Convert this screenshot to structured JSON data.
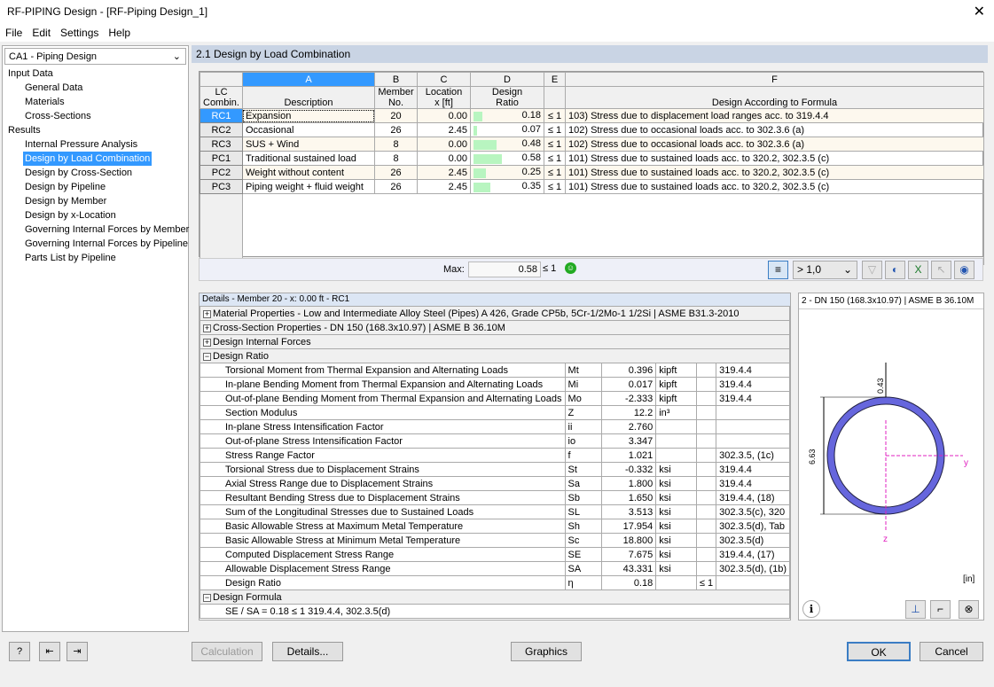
{
  "window": {
    "title": "RF-PIPING Design - [RF-Piping Design_1]"
  },
  "menu": [
    "File",
    "Edit",
    "Settings",
    "Help"
  ],
  "sidebar": {
    "case": "CA1 - Piping Design",
    "groups": [
      {
        "label": "Input Data",
        "items": [
          "General Data",
          "Materials",
          "Cross-Sections"
        ]
      },
      {
        "label": "Results",
        "items": [
          "Internal Pressure Analysis",
          "Design by Load Combination",
          "Design by Cross-Section",
          "Design by Pipeline",
          "Design by Member",
          "Design by x-Location",
          "Governing Internal Forces by Member",
          "Governing Internal Forces by Pipeline",
          "Parts List by Pipeline"
        ]
      }
    ],
    "selected": "Design by Load Combination"
  },
  "main": {
    "title": "2.1 Design by Load Combination",
    "columns": {
      "letters": [
        "A",
        "B",
        "C",
        "D",
        "E",
        "F"
      ],
      "lc": [
        "LC",
        "Combin."
      ],
      "desc": "Description",
      "member": [
        "Member",
        "No."
      ],
      "loc": [
        "Location",
        "x [ft]"
      ],
      "design": [
        "Design",
        "Ratio"
      ],
      "formula": "Design According to Formula"
    },
    "rows": [
      {
        "lc": "RC1",
        "desc": "Expansion",
        "member": "20",
        "x": "0.00",
        "ratio": 0.18,
        "ratio_text": "0.18",
        "le": "≤ 1",
        "formula": "103) Stress due to displacement load ranges acc. to 319.4.4"
      },
      {
        "lc": "RC2",
        "desc": "Occasional",
        "member": "26",
        "x": "2.45",
        "ratio": 0.07,
        "ratio_text": "0.07",
        "le": "≤ 1",
        "formula": "102) Stress due to occasional loads acc. to 302.3.6 (a)"
      },
      {
        "lc": "RC3",
        "desc": "SUS + Wind",
        "member": "8",
        "x": "0.00",
        "ratio": 0.48,
        "ratio_text": "0.48",
        "le": "≤ 1",
        "formula": "102) Stress due to occasional loads acc. to 302.3.6 (a)"
      },
      {
        "lc": "PC1",
        "desc": "Traditional sustained load",
        "member": "8",
        "x": "0.00",
        "ratio": 0.58,
        "ratio_text": "0.58",
        "le": "≤ 1",
        "formula": "101) Stress due to sustained loads acc. to 320.2, 302.3.5 (c)"
      },
      {
        "lc": "PC2",
        "desc": "Weight without content",
        "member": "26",
        "x": "2.45",
        "ratio": 0.25,
        "ratio_text": "0.25",
        "le": "≤ 1",
        "formula": "101) Stress due to sustained loads acc. to 320.2, 302.3.5 (c)"
      },
      {
        "lc": "PC3",
        "desc": "Piping weight + fluid weight",
        "member": "26",
        "x": "2.45",
        "ratio": 0.35,
        "ratio_text": "0.35",
        "le": "≤ 1",
        "formula": "101) Stress due to sustained loads acc. to 320.2, 302.3.5 (c)"
      }
    ],
    "max_label": "Max:",
    "max_value": "0.58",
    "max_le": "≤ 1",
    "filter_value": "> 1,0"
  },
  "details": {
    "title": "Details - Member 20 - x: 0.00 ft - RC1",
    "sections": [
      "Material Properties - Low and Intermediate Alloy Steel (Pipes) A 426, Grade CP5b, 5Cr-1/2Mo-1 1/2Si | ASME B31.3-2010",
      "Cross-Section Properties - DN 150 (168.3x10.97) | ASME B 36.10M",
      "Design Internal Forces",
      "Design Ratio"
    ],
    "rows": [
      [
        "Torsional Moment from Thermal Expansion and Alternating Loads",
        "Mt",
        "0.396",
        "kipft",
        "",
        "319.4.4"
      ],
      [
        "In-plane Bending Moment from Thermal Expansion and Alternating Loads",
        "Mi",
        "0.017",
        "kipft",
        "",
        "319.4.4"
      ],
      [
        "Out-of-plane Bending Moment from Thermal Expansion and Alternating Loads",
        "Mo",
        "-2.333",
        "kipft",
        "",
        "319.4.4"
      ],
      [
        "Section Modulus",
        "Z",
        "12.2",
        "in³",
        "",
        ""
      ],
      [
        "In-plane Stress Intensification Factor",
        "ii",
        "2.760",
        "",
        "",
        ""
      ],
      [
        "Out-of-plane Stress Intensification Factor",
        "io",
        "3.347",
        "",
        "",
        ""
      ],
      [
        "Stress Range Factor",
        "f",
        "1.021",
        "",
        "",
        "302.3.5, (1c)"
      ],
      [
        "Torsional Stress due to Displacement Strains",
        "St",
        "-0.332",
        "ksi",
        "",
        "319.4.4"
      ],
      [
        "Axial Stress Range due to Displacement Strains",
        "Sa",
        "1.800",
        "ksi",
        "",
        "319.4.4"
      ],
      [
        "Resultant Bending Stress due to Displacement Strains",
        "Sb",
        "1.650",
        "ksi",
        "",
        "319.4.4, (18)"
      ],
      [
        "Sum of the Longitudinal Stresses due to Sustained Loads",
        "SL",
        "3.513",
        "ksi",
        "",
        "302.3.5(c), 320"
      ],
      [
        "Basic Allowable Stress at Maximum Metal Temperature",
        "Sh",
        "17.954",
        "ksi",
        "",
        "302.3.5(d), Tab"
      ],
      [
        "Basic Allowable Stress at Minimum Metal Temperature",
        "Sc",
        "18.800",
        "ksi",
        "",
        "302.3.5(d)"
      ],
      [
        "Computed Displacement Stress Range",
        "SE",
        "7.675",
        "ksi",
        "",
        "319.4.4, (17)"
      ],
      [
        "Allowable Displacement Stress Range",
        "SA",
        "43.331",
        "ksi",
        "",
        "302.3.5(d), (1b)"
      ],
      [
        "Design Ratio",
        "η",
        "0.18",
        "",
        "≤ 1",
        ""
      ]
    ],
    "formula_section": "Design Formula",
    "formula": "SE / SA = 0.18 ≤ 1   319.4.4, 302.3.5(d)"
  },
  "graphic": {
    "title": "2 - DN 150 (168.3x10.97) | ASME B 36.10M",
    "dim_t": "0.43",
    "dim_d": "6.63",
    "axis_y": "y",
    "axis_z": "z",
    "unit": "[in]"
  },
  "buttons": {
    "calculation": "Calculation",
    "details": "Details...",
    "graphics": "Graphics",
    "ok": "OK",
    "cancel": "Cancel"
  }
}
